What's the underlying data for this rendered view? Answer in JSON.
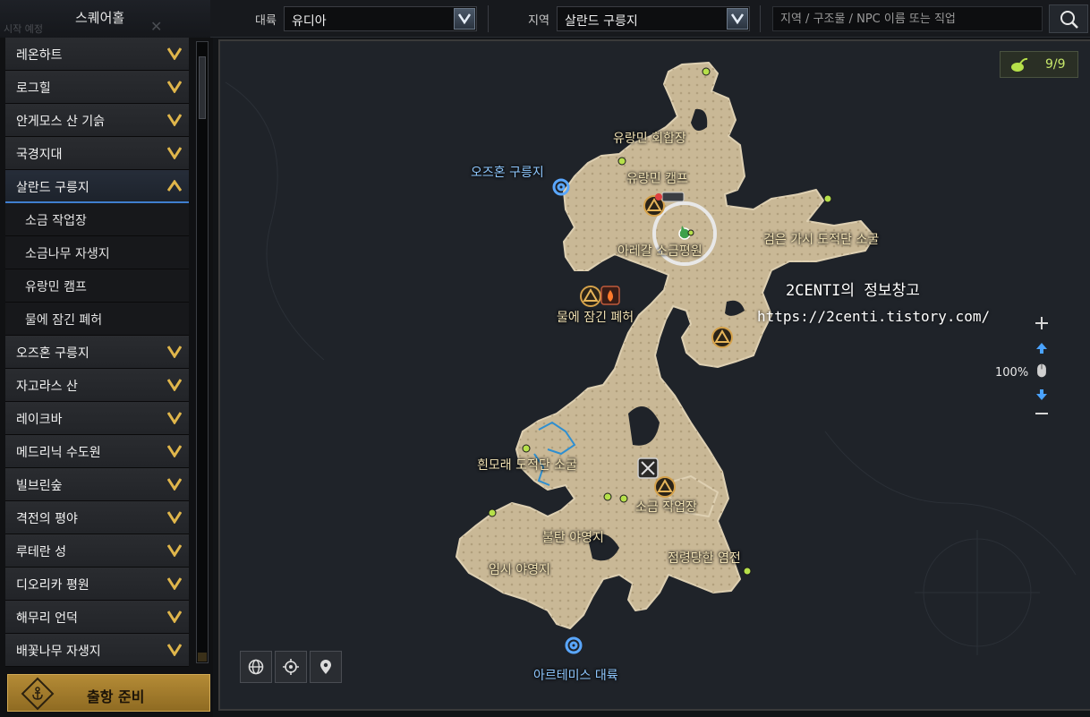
{
  "topbar": {
    "brand": "스퀘어홀",
    "ghost_label": "시작 예정",
    "continent_label": "대륙",
    "continent_value": "유디아",
    "region_label": "지역",
    "region_value": "살란드 구릉지",
    "search_placeholder": "지역 / 구조물 / NPC 이름 또는 직업"
  },
  "sidebar": {
    "regions": [
      {
        "label": "레온하트",
        "expanded": false
      },
      {
        "label": "로그힐",
        "expanded": false
      },
      {
        "label": "안게모스 산 기슭",
        "expanded": false
      },
      {
        "label": "국경지대",
        "expanded": false
      },
      {
        "label": "살란드 구릉지",
        "expanded": true
      },
      {
        "label": "오즈혼 구릉지",
        "expanded": false
      },
      {
        "label": "자고라스 산",
        "expanded": false
      },
      {
        "label": "레이크바",
        "expanded": false
      },
      {
        "label": "메드리닉 수도원",
        "expanded": false
      },
      {
        "label": "빌브린숲",
        "expanded": false
      },
      {
        "label": "격전의 평야",
        "expanded": false
      },
      {
        "label": "루테란 성",
        "expanded": false
      },
      {
        "label": "디오리카 평원",
        "expanded": false
      },
      {
        "label": "해무리 언덕",
        "expanded": false
      },
      {
        "label": "배꽃나무 자생지",
        "expanded": false
      }
    ],
    "subitems": [
      "소금 작업장",
      "소금나무 자생지",
      "유랑민 캠프",
      "물에 잠긴 폐허"
    ],
    "depart_label": "출항 준비"
  },
  "map": {
    "labels": {
      "wanderer_guild": "유랑민 회합장",
      "wanderer_camp": "유랑민 캠프",
      "ozhorn": "오즈혼 구릉지",
      "arethal": "아레갈 소금평원",
      "black_thorn": "검은 가시 도적단 소굴",
      "flooded_ruins": "물에 잠긴 폐허",
      "white_sand": "흰모래 도적단 소굴",
      "salt_workshop": "소금 작업장",
      "burnt_camp": "불탄 야영지",
      "temp_camp": "임시 야영지",
      "occupied_salt": "점령당한 염전",
      "artemis": "아르테미스 대륙"
    },
    "watermark": {
      "title": "2CENTI의 정보창고",
      "url": "https://2centi.tistory.com/"
    },
    "collectible_count": "9/9",
    "zoom": "100%"
  },
  "colors": {
    "land": "#c9b896",
    "map_bg": "#1f2329",
    "label": "#f0e1b3",
    "portal_label": "#8fc8ff",
    "chevron": "#e0b64b",
    "selected": "#3f7fcf"
  }
}
